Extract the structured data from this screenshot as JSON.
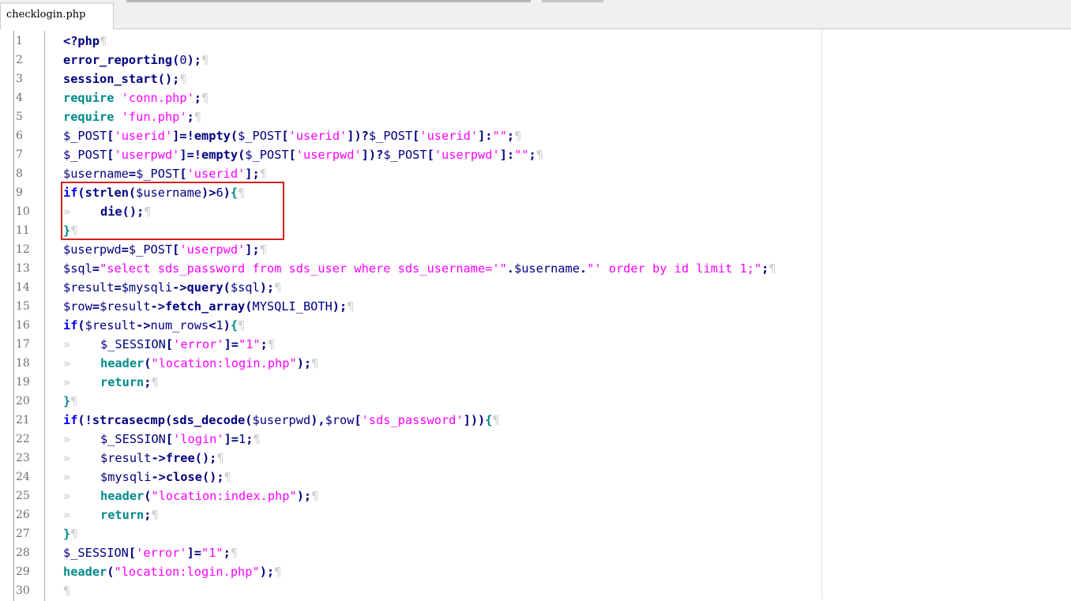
{
  "tabs": [
    {
      "label": "checklogin.php",
      "active": true
    }
  ],
  "editor": {
    "pilcrow": "¶",
    "tab_glyph": "»",
    "lines": [
      {
        "n": "1",
        "tokens": [
          [
            "php",
            "<?php"
          ]
        ]
      },
      {
        "n": "2",
        "tokens": [
          [
            "fn",
            "error_reporting"
          ],
          [
            "op",
            "("
          ],
          [
            "num",
            "0"
          ],
          [
            "op",
            ");"
          ]
        ]
      },
      {
        "n": "3",
        "tokens": [
          [
            "fn",
            "session_start"
          ],
          [
            "op",
            "();"
          ]
        ]
      },
      {
        "n": "4",
        "tokens": [
          [
            "kw2",
            "require"
          ],
          [
            "plain",
            " "
          ],
          [
            "str",
            "'conn.php'"
          ],
          [
            "op",
            ";"
          ]
        ]
      },
      {
        "n": "5",
        "tokens": [
          [
            "kw2",
            "require"
          ],
          [
            "plain",
            " "
          ],
          [
            "str",
            "'fun.php'"
          ],
          [
            "op",
            ";"
          ]
        ]
      },
      {
        "n": "6",
        "tokens": [
          [
            "var",
            "$_POST"
          ],
          [
            "op",
            "["
          ],
          [
            "str",
            "'userid'"
          ],
          [
            "op",
            "]=!"
          ],
          [
            "fn",
            "empty"
          ],
          [
            "op",
            "("
          ],
          [
            "var",
            "$_POST"
          ],
          [
            "op",
            "["
          ],
          [
            "str",
            "'userid'"
          ],
          [
            "op",
            "])?"
          ],
          [
            "var",
            "$_POST"
          ],
          [
            "op",
            "["
          ],
          [
            "str",
            "'userid'"
          ],
          [
            "op",
            "]:"
          ],
          [
            "str",
            "\"\""
          ],
          [
            "op",
            ";"
          ]
        ]
      },
      {
        "n": "7",
        "tokens": [
          [
            "var",
            "$_POST"
          ],
          [
            "op",
            "["
          ],
          [
            "str",
            "'userpwd'"
          ],
          [
            "op",
            "]=!"
          ],
          [
            "fn",
            "empty"
          ],
          [
            "op",
            "("
          ],
          [
            "var",
            "$_POST"
          ],
          [
            "op",
            "["
          ],
          [
            "str",
            "'userpwd'"
          ],
          [
            "op",
            "])?"
          ],
          [
            "var",
            "$_POST"
          ],
          [
            "op",
            "["
          ],
          [
            "str",
            "'userpwd'"
          ],
          [
            "op",
            "]:"
          ],
          [
            "str",
            "\"\""
          ],
          [
            "op",
            ";"
          ]
        ]
      },
      {
        "n": "8",
        "tokens": [
          [
            "var",
            "$username"
          ],
          [
            "op",
            "="
          ],
          [
            "var",
            "$_POST"
          ],
          [
            "op",
            "["
          ],
          [
            "str",
            "'userid'"
          ],
          [
            "op",
            "];"
          ]
        ]
      },
      {
        "n": "9",
        "tokens": [
          [
            "kw",
            "if"
          ],
          [
            "op",
            "("
          ],
          [
            "fn",
            "strlen"
          ],
          [
            "op",
            "("
          ],
          [
            "var",
            "$username"
          ],
          [
            "op",
            ")>"
          ],
          [
            "num",
            "6"
          ],
          [
            "op",
            ")"
          ],
          [
            "kw2",
            "{"
          ]
        ]
      },
      {
        "n": "10",
        "tokens": [
          [
            "tab",
            ""
          ],
          [
            "fn",
            "die"
          ],
          [
            "op",
            "();"
          ]
        ]
      },
      {
        "n": "11",
        "tokens": [
          [
            "kw2",
            "}"
          ]
        ]
      },
      {
        "n": "12",
        "tokens": [
          [
            "var",
            "$userpwd"
          ],
          [
            "op",
            "="
          ],
          [
            "var",
            "$_POST"
          ],
          [
            "op",
            "["
          ],
          [
            "str",
            "'userpwd'"
          ],
          [
            "op",
            "];"
          ]
        ]
      },
      {
        "n": "13",
        "tokens": [
          [
            "var",
            "$sql"
          ],
          [
            "op",
            "="
          ],
          [
            "str",
            "\"select sds_password from sds_user where sds_username='\""
          ],
          [
            "op",
            "."
          ],
          [
            "var",
            "$username"
          ],
          [
            "op",
            "."
          ],
          [
            "str",
            "\"' order by id limit 1;\""
          ],
          [
            "op",
            ";"
          ]
        ]
      },
      {
        "n": "14",
        "tokens": [
          [
            "var",
            "$result"
          ],
          [
            "op",
            "="
          ],
          [
            "var",
            "$mysqli"
          ],
          [
            "op",
            "->"
          ],
          [
            "fn",
            "query"
          ],
          [
            "op",
            "("
          ],
          [
            "var",
            "$sql"
          ],
          [
            "op",
            ");"
          ]
        ]
      },
      {
        "n": "15",
        "tokens": [
          [
            "var",
            "$row"
          ],
          [
            "op",
            "="
          ],
          [
            "var",
            "$result"
          ],
          [
            "op",
            "->"
          ],
          [
            "fn",
            "fetch_array"
          ],
          [
            "op",
            "("
          ],
          [
            "var",
            "MYSQLI_BOTH"
          ],
          [
            "op",
            ");"
          ]
        ]
      },
      {
        "n": "16",
        "tokens": [
          [
            "kw",
            "if"
          ],
          [
            "op",
            "("
          ],
          [
            "var",
            "$result"
          ],
          [
            "op",
            "->"
          ],
          [
            "var",
            "num_rows"
          ],
          [
            "op",
            "<"
          ],
          [
            "num",
            "1"
          ],
          [
            "op",
            ")"
          ],
          [
            "kw2",
            "{"
          ]
        ]
      },
      {
        "n": "17",
        "tokens": [
          [
            "tab",
            ""
          ],
          [
            "var",
            "$_SESSION"
          ],
          [
            "op",
            "["
          ],
          [
            "str",
            "'error'"
          ],
          [
            "op",
            "]="
          ],
          [
            "str",
            "\"1\""
          ],
          [
            "op",
            ";"
          ]
        ]
      },
      {
        "n": "18",
        "tokens": [
          [
            "tab",
            ""
          ],
          [
            "kw2",
            "header"
          ],
          [
            "op",
            "("
          ],
          [
            "str",
            "\"location:login.php\""
          ],
          [
            "op",
            ");"
          ]
        ]
      },
      {
        "n": "19",
        "tokens": [
          [
            "tab",
            ""
          ],
          [
            "kw2",
            "return"
          ],
          [
            "op",
            ";"
          ]
        ]
      },
      {
        "n": "20",
        "tokens": [
          [
            "kw2",
            "}"
          ]
        ]
      },
      {
        "n": "21",
        "tokens": [
          [
            "kw",
            "if"
          ],
          [
            "op",
            "(!"
          ],
          [
            "fn",
            "strcasecmp"
          ],
          [
            "op",
            "("
          ],
          [
            "fn",
            "sds_decode"
          ],
          [
            "op",
            "("
          ],
          [
            "var",
            "$userpwd"
          ],
          [
            "op",
            "),"
          ],
          [
            "var",
            "$row"
          ],
          [
            "op",
            "["
          ],
          [
            "str",
            "'sds_password'"
          ],
          [
            "op",
            "]))"
          ],
          [
            "kw2",
            "{"
          ]
        ]
      },
      {
        "n": "22",
        "tokens": [
          [
            "tab",
            ""
          ],
          [
            "var",
            "$_SESSION"
          ],
          [
            "op",
            "["
          ],
          [
            "str",
            "'login'"
          ],
          [
            "op",
            "]="
          ],
          [
            "num",
            "1"
          ],
          [
            "op",
            ";"
          ]
        ]
      },
      {
        "n": "23",
        "tokens": [
          [
            "tab",
            ""
          ],
          [
            "var",
            "$result"
          ],
          [
            "op",
            "->"
          ],
          [
            "fn",
            "free"
          ],
          [
            "op",
            "();"
          ]
        ]
      },
      {
        "n": "24",
        "tokens": [
          [
            "tab",
            ""
          ],
          [
            "var",
            "$mysqli"
          ],
          [
            "op",
            "->"
          ],
          [
            "fn",
            "close"
          ],
          [
            "op",
            "();"
          ]
        ]
      },
      {
        "n": "25",
        "tokens": [
          [
            "tab",
            ""
          ],
          [
            "kw2",
            "header"
          ],
          [
            "op",
            "("
          ],
          [
            "str",
            "\"location:index.php\""
          ],
          [
            "op",
            ");"
          ]
        ]
      },
      {
        "n": "26",
        "tokens": [
          [
            "tab",
            ""
          ],
          [
            "kw2",
            "return"
          ],
          [
            "op",
            ";"
          ]
        ]
      },
      {
        "n": "27",
        "tokens": [
          [
            "kw2",
            "}"
          ]
        ]
      },
      {
        "n": "28",
        "tokens": [
          [
            "var",
            "$_SESSION"
          ],
          [
            "op",
            "["
          ],
          [
            "str",
            "'error'"
          ],
          [
            "op",
            "]="
          ],
          [
            "str",
            "\"1\""
          ],
          [
            "op",
            ";"
          ]
        ]
      },
      {
        "n": "29",
        "tokens": [
          [
            "kw2",
            "header"
          ],
          [
            "op",
            "("
          ],
          [
            "str",
            "\"location:login.php\""
          ],
          [
            "op",
            ");"
          ]
        ]
      },
      {
        "n": "30",
        "tokens": []
      }
    ]
  },
  "colors": {
    "keyword": "#0000ff",
    "keyword_alt": "#008a8a",
    "string": "#ff00ff",
    "identifier": "#000080",
    "highlight_box": "#d42020"
  }
}
